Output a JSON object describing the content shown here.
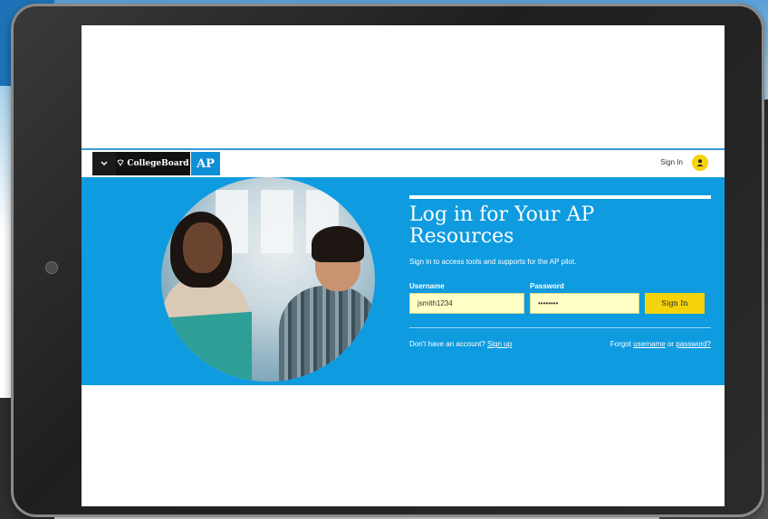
{
  "navbar": {
    "menu_icon": "chevron-down-icon",
    "collegeboard_logo": "CollegeBoard",
    "ap_logo": "AP",
    "signin_label": "Sign In",
    "avatar_icon": "user-icon"
  },
  "login": {
    "headline": "Log in for Your AP Resources",
    "subtext": "Sign in to access tools and supports for the AP pilot.",
    "username_label": "Username",
    "username_value": "jsmith1234",
    "password_label": "Password",
    "password_value": "••••••••",
    "signin_button": "Sign In",
    "no_account_text": "Don't have an account?",
    "signup_link": "Sign up",
    "forgot_text": "Forgot",
    "username_link": "username",
    "or_text": "or",
    "password_link": "password?"
  },
  "colors": {
    "hero_blue": "#0e9be0",
    "accent_yellow": "#f5d30a",
    "input_bg": "#ffffc6",
    "nav_border": "#3a9ad9"
  }
}
